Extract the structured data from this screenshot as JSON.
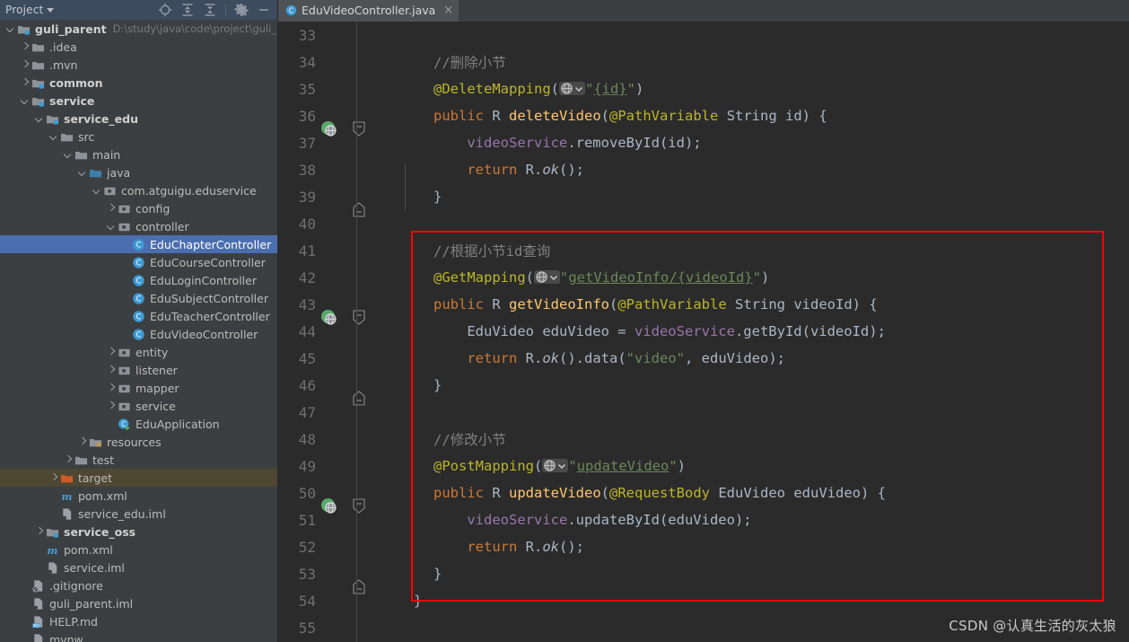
{
  "panel": {
    "title": "Project",
    "icons": [
      "locate-icon",
      "expand-all-icon",
      "collapse-all-icon",
      "gear-icon",
      "minimize-icon"
    ]
  },
  "tree": [
    {
      "depth": 0,
      "arrow": "d",
      "icon": "module-icon",
      "label": "guli_parent",
      "bold": true,
      "path": "D:\\study\\java\\code\\project\\guli_pare"
    },
    {
      "depth": 1,
      "arrow": "r",
      "icon": "folder-icon",
      "label": ".idea",
      "bold": false,
      "path": ""
    },
    {
      "depth": 1,
      "arrow": "r",
      "icon": "folder-icon",
      "label": ".mvn",
      "bold": false,
      "path": ""
    },
    {
      "depth": 1,
      "arrow": "r",
      "icon": "module-icon",
      "label": "common",
      "bold": true,
      "path": ""
    },
    {
      "depth": 1,
      "arrow": "d",
      "icon": "module-icon",
      "label": "service",
      "bold": true,
      "path": ""
    },
    {
      "depth": 2,
      "arrow": "d",
      "icon": "module-icon",
      "label": "service_edu",
      "bold": true,
      "path": ""
    },
    {
      "depth": 3,
      "arrow": "d",
      "icon": "folder-icon",
      "label": "src",
      "bold": false,
      "path": ""
    },
    {
      "depth": 4,
      "arrow": "d",
      "icon": "folder-icon",
      "label": "main",
      "bold": false,
      "path": ""
    },
    {
      "depth": 5,
      "arrow": "d",
      "icon": "source-folder-icon",
      "label": "java",
      "bold": false,
      "path": ""
    },
    {
      "depth": 6,
      "arrow": "d",
      "icon": "package-icon",
      "label": "com.atguigu.eduservice",
      "bold": false,
      "path": ""
    },
    {
      "depth": 7,
      "arrow": "r",
      "icon": "package-icon",
      "label": "config",
      "bold": false,
      "path": ""
    },
    {
      "depth": 7,
      "arrow": "d",
      "icon": "package-icon",
      "label": "controller",
      "bold": false,
      "path": ""
    },
    {
      "depth": 8,
      "arrow": "",
      "icon": "class-icon",
      "label": "EduChapterController",
      "bold": false,
      "path": "",
      "selected": true
    },
    {
      "depth": 8,
      "arrow": "",
      "icon": "class-icon",
      "label": "EduCourseController",
      "bold": false,
      "path": ""
    },
    {
      "depth": 8,
      "arrow": "",
      "icon": "class-icon",
      "label": "EduLoginController",
      "bold": false,
      "path": ""
    },
    {
      "depth": 8,
      "arrow": "",
      "icon": "class-icon",
      "label": "EduSubjectController",
      "bold": false,
      "path": ""
    },
    {
      "depth": 8,
      "arrow": "",
      "icon": "class-icon",
      "label": "EduTeacherController",
      "bold": false,
      "path": ""
    },
    {
      "depth": 8,
      "arrow": "",
      "icon": "class-icon",
      "label": "EduVideoController",
      "bold": false,
      "path": ""
    },
    {
      "depth": 7,
      "arrow": "r",
      "icon": "package-icon",
      "label": "entity",
      "bold": false,
      "path": ""
    },
    {
      "depth": 7,
      "arrow": "r",
      "icon": "package-icon",
      "label": "listener",
      "bold": false,
      "path": ""
    },
    {
      "depth": 7,
      "arrow": "r",
      "icon": "package-icon",
      "label": "mapper",
      "bold": false,
      "path": ""
    },
    {
      "depth": 7,
      "arrow": "r",
      "icon": "package-icon",
      "label": "service",
      "bold": false,
      "path": ""
    },
    {
      "depth": 7,
      "arrow": "",
      "icon": "spring-class-icon",
      "label": "EduApplication",
      "bold": false,
      "path": ""
    },
    {
      "depth": 5,
      "arrow": "r",
      "icon": "resource-folder-icon",
      "label": "resources",
      "bold": false,
      "path": ""
    },
    {
      "depth": 4,
      "arrow": "r",
      "icon": "folder-icon",
      "label": "test",
      "bold": false,
      "path": ""
    },
    {
      "depth": 3,
      "arrow": "r",
      "icon": "target-folder-icon",
      "label": "target",
      "bold": false,
      "path": "",
      "highlight": true
    },
    {
      "depth": 3,
      "arrow": "",
      "icon": "maven-icon",
      "label": "pom.xml",
      "bold": false,
      "path": ""
    },
    {
      "depth": 3,
      "arrow": "",
      "icon": "iml-icon",
      "label": "service_edu.iml",
      "bold": false,
      "path": ""
    },
    {
      "depth": 2,
      "arrow": "r",
      "icon": "module-icon",
      "label": "service_oss",
      "bold": true,
      "path": ""
    },
    {
      "depth": 2,
      "arrow": "",
      "icon": "maven-icon",
      "label": "pom.xml",
      "bold": false,
      "path": ""
    },
    {
      "depth": 2,
      "arrow": "",
      "icon": "iml-icon",
      "label": "service.iml",
      "bold": false,
      "path": ""
    },
    {
      "depth": 1,
      "arrow": "",
      "icon": "gitignore-icon",
      "label": ".gitignore",
      "bold": false,
      "path": ""
    },
    {
      "depth": 1,
      "arrow": "",
      "icon": "iml-icon",
      "label": "guli_parent.iml",
      "bold": false,
      "path": ""
    },
    {
      "depth": 1,
      "arrow": "",
      "icon": "markdown-icon",
      "label": "HELP.md",
      "bold": false,
      "path": ""
    },
    {
      "depth": 1,
      "arrow": "",
      "icon": "file-icon",
      "label": "mvnw",
      "bold": false,
      "path": ""
    }
  ],
  "tab": {
    "icon": "java-class-icon",
    "label": "EduVideoController.java",
    "close": "×"
  },
  "editor": {
    "first_line": 33,
    "last_line": 55,
    "lines": [
      {
        "n": 33,
        "gutter": "",
        "fold": "",
        "html": ""
      },
      {
        "n": 34,
        "gutter": "",
        "fold": "",
        "html": "<span class=\"cmt\">//删除小节</span>"
      },
      {
        "n": 35,
        "gutter": "",
        "fold": "",
        "html": "<span class=\"ann\">@DeleteMapping</span><span class=\"txt\">(</span>@GLOBE@<span class=\"str\">\"</span><span class=\"str ulink\">{id}</span><span class=\"str\">\"</span><span class=\"txt\">)</span>"
      },
      {
        "n": 36,
        "gutter": "web-icon",
        "fold": "open",
        "html": "<span class=\"kw\">public</span> <span class=\"txt\">R </span><span class=\"mth\">deleteVideo</span><span class=\"txt\">(</span><span class=\"ann\">@PathVariable</span> <span class=\"txt\">String id) {</span>"
      },
      {
        "n": 37,
        "gutter": "",
        "fold": "",
        "html": "    <span class=\"fld\">videoService</span><span class=\"txt\">.removeById(id);</span>"
      },
      {
        "n": 38,
        "gutter": "",
        "fold": "",
        "html": "    <span class=\"kw\">return</span> <span class=\"txt\">R.</span><span class=\"txt ital\">ok</span><span class=\"txt\">();</span>"
      },
      {
        "n": 39,
        "gutter": "",
        "fold": "close",
        "html": "<span class=\"txt\">}</span>"
      },
      {
        "n": 40,
        "gutter": "",
        "fold": "",
        "html": ""
      },
      {
        "n": 41,
        "gutter": "",
        "fold": "",
        "html": "<span class=\"cmt\">//根据小节id查询</span>"
      },
      {
        "n": 42,
        "gutter": "",
        "fold": "",
        "html": "<span class=\"ann\">@GetMapping</span><span class=\"txt\">(</span>@GLOBE@<span class=\"str\">\"</span><span class=\"str ulink2\">getVideoInfo/{videoId}</span><span class=\"str\">\"</span><span class=\"txt\">)</span>"
      },
      {
        "n": 43,
        "gutter": "web-icon",
        "fold": "open",
        "html": "<span class=\"kw\">public</span> <span class=\"txt\">R </span><span class=\"mth\">getVideoInfo</span><span class=\"txt\">(</span><span class=\"ann\">@PathVariable</span> <span class=\"txt\">String videoId) {</span>"
      },
      {
        "n": 44,
        "gutter": "",
        "fold": "",
        "html": "    <span class=\"txt\">EduVideo eduVideo = </span><span class=\"fld\">videoService</span><span class=\"txt\">.getById(videoId);</span>"
      },
      {
        "n": 45,
        "gutter": "",
        "fold": "",
        "html": "    <span class=\"kw\">return</span> <span class=\"txt\">R.</span><span class=\"txt ital\">ok</span><span class=\"txt\">().data(</span><span class=\"str\">\"video\"</span><span class=\"txt\">, eduVideo);</span>"
      },
      {
        "n": 46,
        "gutter": "",
        "fold": "close",
        "html": "<span class=\"txt\">}</span>"
      },
      {
        "n": 47,
        "gutter": "",
        "fold": "",
        "html": ""
      },
      {
        "n": 48,
        "gutter": "",
        "fold": "",
        "html": "<span class=\"cmt\">//修改小节</span>"
      },
      {
        "n": 49,
        "gutter": "",
        "fold": "",
        "html": "<span class=\"ann\">@PostMapping</span><span class=\"txt\">(</span>@GLOBE@<span class=\"str\">\"</span><span class=\"str ulink2\">updateVideo</span><span class=\"str\">\"</span><span class=\"txt\">)</span>"
      },
      {
        "n": 50,
        "gutter": "web-icon",
        "fold": "open",
        "html": "<span class=\"kw\">public</span> <span class=\"txt\">R </span><span class=\"mth\">updateVideo</span><span class=\"txt\">(</span><span class=\"ann\">@RequestBody</span> <span class=\"txt\">EduVideo eduVideo) {</span>"
      },
      {
        "n": 51,
        "gutter": "",
        "fold": "",
        "html": "    <span class=\"fld\">videoService</span><span class=\"txt\">.updateById(eduVideo);</span>"
      },
      {
        "n": 52,
        "gutter": "",
        "fold": "",
        "html": "    <span class=\"kw\">return</span> <span class=\"txt\">R.</span><span class=\"txt ital\">ok</span><span class=\"txt\">();</span>"
      },
      {
        "n": 53,
        "gutter": "",
        "fold": "close",
        "html": "<span class=\"txt\">}</span>"
      },
      {
        "n": 54,
        "gutter": "",
        "fold": "",
        "html": "<span class=\"txt\">}</span>",
        "outdent": true
      },
      {
        "n": 55,
        "gutter": "",
        "fold": "",
        "html": ""
      }
    ]
  },
  "annotation": {
    "red_box_color": "#ff0000"
  },
  "watermark": "CSDN @认真生活的灰太狼"
}
